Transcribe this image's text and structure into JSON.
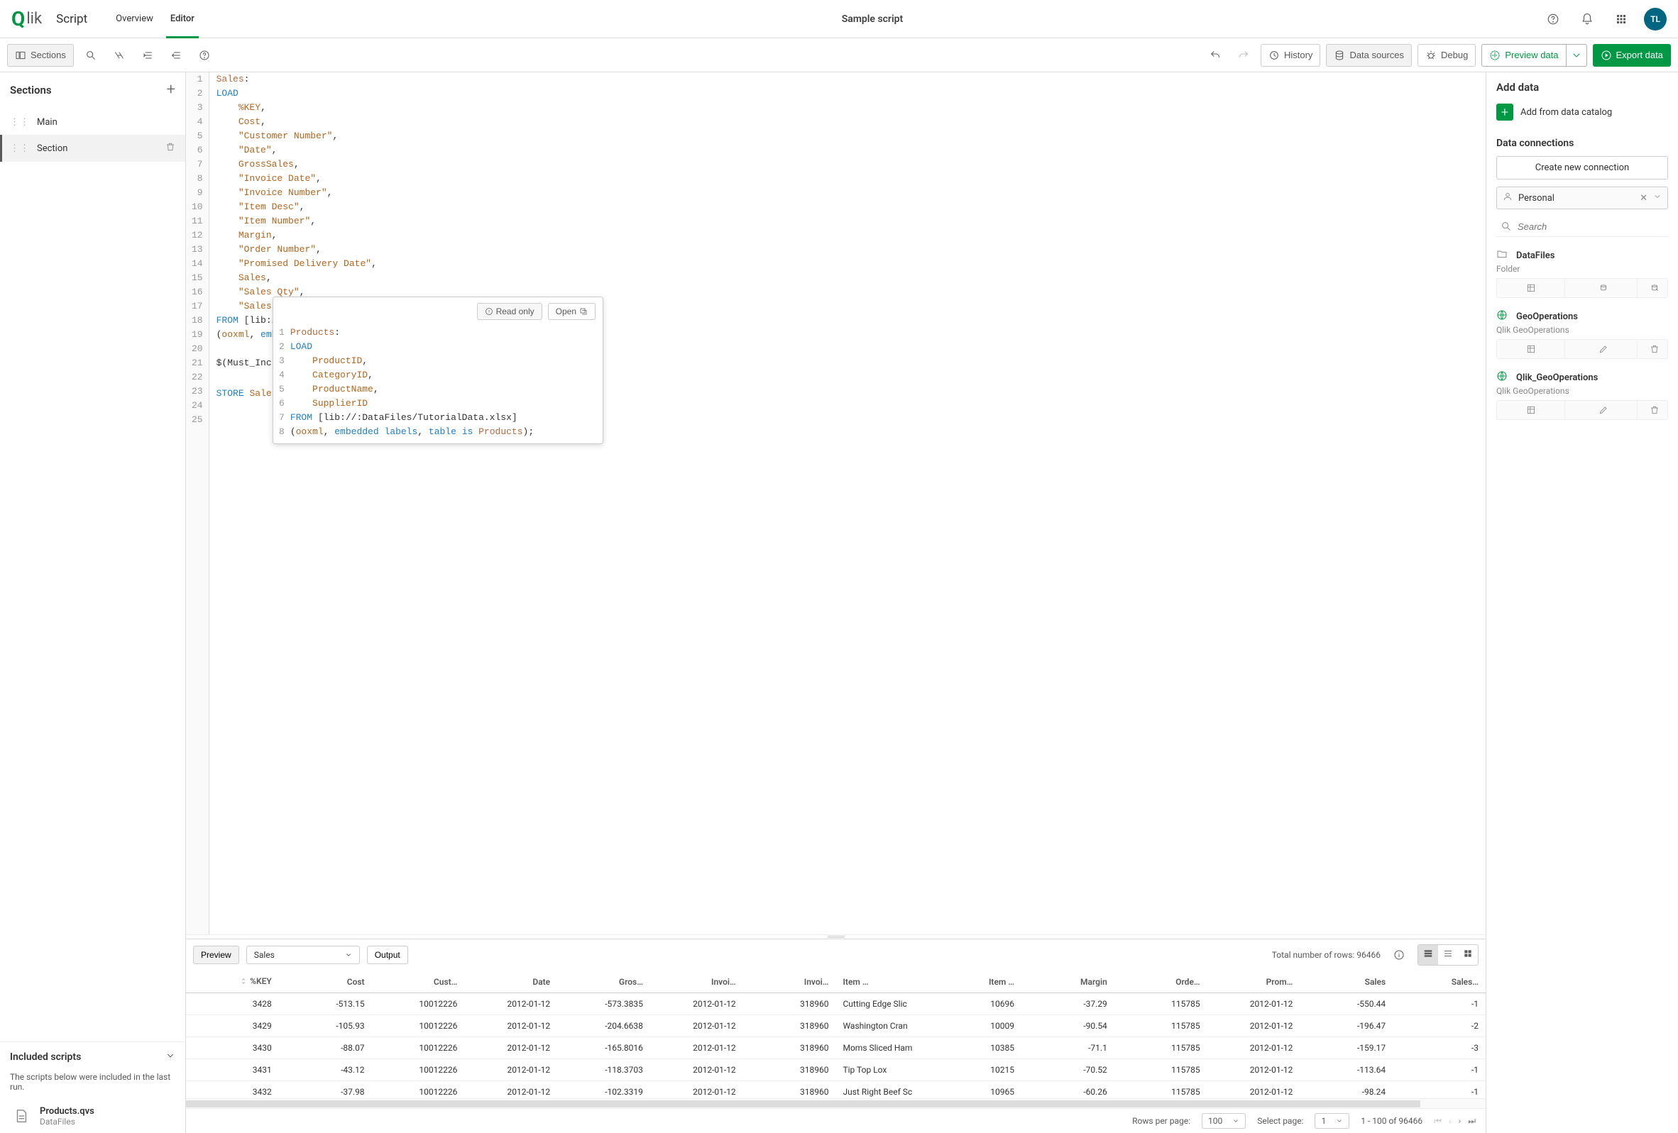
{
  "header": {
    "script_label": "Script",
    "overview": "Overview",
    "editor": "Editor",
    "title": "Sample script",
    "avatar": "TL"
  },
  "toolbar": {
    "sections": "Sections",
    "history": "History",
    "data_sources": "Data sources",
    "debug": "Debug",
    "preview": "Preview data",
    "export": "Export data"
  },
  "sections": {
    "heading": "Sections",
    "items": [
      "Main",
      "Section"
    ]
  },
  "included": {
    "heading": "Included scripts",
    "note": "The scripts below were included in the last run.",
    "item_title": "Products.qvs",
    "item_sub": "DataFiles"
  },
  "code_lines": [
    [
      {
        "c": "c-tbl",
        "t": "Sales"
      },
      {
        "c": "c-pl",
        "t": ":"
      }
    ],
    [
      {
        "c": "c-kw",
        "t": "LOAD"
      }
    ],
    [
      {
        "c": "c-pl",
        "t": "    "
      },
      {
        "c": "c-id",
        "t": "%KEY"
      },
      {
        "c": "c-pl",
        "t": ","
      }
    ],
    [
      {
        "c": "c-pl",
        "t": "    "
      },
      {
        "c": "c-id",
        "t": "Cost"
      },
      {
        "c": "c-pl",
        "t": ","
      }
    ],
    [
      {
        "c": "c-pl",
        "t": "    "
      },
      {
        "c": "c-str",
        "t": "\"Customer Number\""
      },
      {
        "c": "c-pl",
        "t": ","
      }
    ],
    [
      {
        "c": "c-pl",
        "t": "    "
      },
      {
        "c": "c-str",
        "t": "\"Date\""
      },
      {
        "c": "c-pl",
        "t": ","
      }
    ],
    [
      {
        "c": "c-pl",
        "t": "    "
      },
      {
        "c": "c-id",
        "t": "GrossSales"
      },
      {
        "c": "c-pl",
        "t": ","
      }
    ],
    [
      {
        "c": "c-pl",
        "t": "    "
      },
      {
        "c": "c-str",
        "t": "\"Invoice Date\""
      },
      {
        "c": "c-pl",
        "t": ","
      }
    ],
    [
      {
        "c": "c-pl",
        "t": "    "
      },
      {
        "c": "c-str",
        "t": "\"Invoice Number\""
      },
      {
        "c": "c-pl",
        "t": ","
      }
    ],
    [
      {
        "c": "c-pl",
        "t": "    "
      },
      {
        "c": "c-str",
        "t": "\"Item Desc\""
      },
      {
        "c": "c-pl",
        "t": ","
      }
    ],
    [
      {
        "c": "c-pl",
        "t": "    "
      },
      {
        "c": "c-str",
        "t": "\"Item Number\""
      },
      {
        "c": "c-pl",
        "t": ","
      }
    ],
    [
      {
        "c": "c-pl",
        "t": "    "
      },
      {
        "c": "c-id",
        "t": "Margin"
      },
      {
        "c": "c-pl",
        "t": ","
      }
    ],
    [
      {
        "c": "c-pl",
        "t": "    "
      },
      {
        "c": "c-str",
        "t": "\"Order Number\""
      },
      {
        "c": "c-pl",
        "t": ","
      }
    ],
    [
      {
        "c": "c-pl",
        "t": "    "
      },
      {
        "c": "c-str",
        "t": "\"Promised Delivery Date\""
      },
      {
        "c": "c-pl",
        "t": ","
      }
    ],
    [
      {
        "c": "c-pl",
        "t": "    "
      },
      {
        "c": "c-id",
        "t": "Sales"
      },
      {
        "c": "c-pl",
        "t": ","
      }
    ],
    [
      {
        "c": "c-pl",
        "t": "    "
      },
      {
        "c": "c-str",
        "t": "\"Sales Qty\""
      },
      {
        "c": "c-pl",
        "t": ","
      }
    ],
    [
      {
        "c": "c-pl",
        "t": "    "
      },
      {
        "c": "c-str",
        "t": "\"Sales Rep Number\""
      }
    ],
    [
      {
        "c": "c-kw",
        "t": "FROM"
      },
      {
        "c": "c-pl",
        "t": " [lib://DataFiles/Sales.xlsx]"
      }
    ],
    [
      {
        "c": "c-pl",
        "t": "("
      },
      {
        "c": "c-id",
        "t": "ooxml"
      },
      {
        "c": "c-pl",
        "t": ", "
      },
      {
        "c": "c-kw",
        "t": "embedded labels"
      },
      {
        "c": "c-pl",
        "t": ", "
      },
      {
        "c": "c-kw",
        "t": "table is"
      },
      {
        "c": "c-pl",
        "t": " "
      },
      {
        "c": "c-tbl",
        "t": "Sales"
      },
      {
        "c": "c-pl",
        "t": ");"
      }
    ],
    [],
    [
      {
        "c": "c-pl",
        "t": "$(Must_Include=lib://DataFiles/Products.qvs);",
        "expand": true
      }
    ],
    [],
    [
      {
        "c": "c-kw",
        "t": "STORE"
      },
      {
        "c": "c-pl",
        "t": " "
      },
      {
        "c": "c-id",
        "t": "Sales"
      }
    ],
    [],
    []
  ],
  "popup": {
    "read_only": "Read only",
    "open": "Open",
    "lines": [
      [
        {
          "c": "c-tbl",
          "t": "Products"
        },
        {
          "c": "c-pl",
          "t": ":"
        }
      ],
      [
        {
          "c": "c-kw",
          "t": "LOAD"
        }
      ],
      [
        {
          "c": "c-pl",
          "t": "    "
        },
        {
          "c": "c-id",
          "t": "ProductID"
        },
        {
          "c": "c-pl",
          "t": ","
        }
      ],
      [
        {
          "c": "c-pl",
          "t": "    "
        },
        {
          "c": "c-id",
          "t": "CategoryID"
        },
        {
          "c": "c-pl",
          "t": ","
        }
      ],
      [
        {
          "c": "c-pl",
          "t": "    "
        },
        {
          "c": "c-id",
          "t": "ProductName"
        },
        {
          "c": "c-pl",
          "t": ","
        }
      ],
      [
        {
          "c": "c-pl",
          "t": "    "
        },
        {
          "c": "c-id",
          "t": "SupplierID"
        }
      ],
      [
        {
          "c": "c-kw",
          "t": "FROM"
        },
        {
          "c": "c-pl",
          "t": " [lib://:DataFiles/TutorialData.xlsx]"
        }
      ],
      [
        {
          "c": "c-pl",
          "t": "("
        },
        {
          "c": "c-id",
          "t": "ooxml"
        },
        {
          "c": "c-pl",
          "t": ", "
        },
        {
          "c": "c-kw",
          "t": "embedded labels"
        },
        {
          "c": "c-pl",
          "t": ", "
        },
        {
          "c": "c-kw",
          "t": "table is"
        },
        {
          "c": "c-pl",
          "t": " "
        },
        {
          "c": "c-tbl",
          "t": "Products"
        },
        {
          "c": "c-pl",
          "t": ");"
        }
      ]
    ]
  },
  "right": {
    "add_data": "Add data",
    "add_catalog": "Add from data catalog",
    "connections": "Data connections",
    "create": "Create new connection",
    "personal": "Personal",
    "search_ph": "Search",
    "datafiles": "DataFiles",
    "folder": "Folder",
    "geo1": "GeoOperations",
    "geo1_sub": "Qlik GeoOperations",
    "geo2": "Qlik_GeoOperations",
    "geo2_sub": "Qlik GeoOperations"
  },
  "bottom_tb": {
    "preview": "Preview",
    "table": "Sales",
    "output": "Output",
    "total": "Total number of rows: 96466"
  },
  "table": {
    "headers": [
      "%KEY",
      "Cost",
      "Cust…",
      "Date",
      "Gros…",
      "Invoi…",
      "Invoi…",
      "Item …",
      "Item …",
      "Margin",
      "Orde…",
      "Prom…",
      "Sales",
      "Sales…"
    ],
    "rows": [
      [
        "3428",
        "-513.15",
        "10012226",
        "2012-01-12",
        "-573.3835",
        "2012-01-12",
        "318960",
        "Cutting Edge Slic",
        "10696",
        "-37.29",
        "115785",
        "2012-01-12",
        "-550.44",
        "-1"
      ],
      [
        "3429",
        "-105.93",
        "10012226",
        "2012-01-12",
        "-204.6638",
        "2012-01-12",
        "318960",
        "Washington Cran",
        "10009",
        "-90.54",
        "115785",
        "2012-01-12",
        "-196.47",
        "-2"
      ],
      [
        "3430",
        "-88.07",
        "10012226",
        "2012-01-12",
        "-165.8016",
        "2012-01-12",
        "318960",
        "Moms Sliced Ham",
        "10385",
        "-71.1",
        "115785",
        "2012-01-12",
        "-159.17",
        "-3"
      ],
      [
        "3431",
        "-43.12",
        "10012226",
        "2012-01-12",
        "-118.3703",
        "2012-01-12",
        "318960",
        "Tip Top Lox",
        "10215",
        "-70.52",
        "115785",
        "2012-01-12",
        "-113.64",
        "-1"
      ],
      [
        "3432",
        "-37.98",
        "10012226",
        "2012-01-12",
        "-102.3319",
        "2012-01-12",
        "318960",
        "Just Right Beef Sc",
        "10965",
        "-60.26",
        "115785",
        "2012-01-12",
        "-98.24",
        "-1"
      ]
    ]
  },
  "footer": {
    "rpp_label": "Rows per page:",
    "rpp_value": "100",
    "sp_label": "Select page:",
    "sp_value": "1",
    "range": "1 - 100 of 96466"
  }
}
